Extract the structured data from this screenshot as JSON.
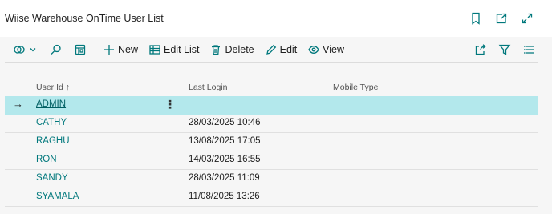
{
  "window": {
    "title": "Wiise Warehouse OnTime User List",
    "icons": [
      "bookmark-icon",
      "open-new-window-icon",
      "expand-icon"
    ]
  },
  "toolbar": {
    "new_label": "New",
    "edit_list_label": "Edit List",
    "delete_label": "Delete",
    "edit_label": "Edit",
    "view_label": "View"
  },
  "columns": {
    "user_id": "User Id",
    "user_id_sort": "↑",
    "last_login": "Last Login",
    "mobile_type": "Mobile Type"
  },
  "rows": [
    {
      "user_id": "ADMIN",
      "last_login": "",
      "mobile_type": "",
      "selected": true
    },
    {
      "user_id": "CATHY",
      "last_login": "28/03/2025 10:46",
      "mobile_type": ""
    },
    {
      "user_id": "RAGHU",
      "last_login": "13/08/2025 17:05",
      "mobile_type": ""
    },
    {
      "user_id": "RON",
      "last_login": "14/03/2025 16:55",
      "mobile_type": ""
    },
    {
      "user_id": "SANDY",
      "last_login": "28/03/2025 11:09",
      "mobile_type": ""
    },
    {
      "user_id": "SYAMALA",
      "last_login": "11/08/2025 13:26",
      "mobile_type": ""
    }
  ],
  "glyphs": {
    "row_arrow": "→",
    "row_menu": "⋮"
  },
  "colors": {
    "accent": "#00787c",
    "selected_row": "#b3e8ec",
    "content_bg": "#f6f6f6"
  }
}
